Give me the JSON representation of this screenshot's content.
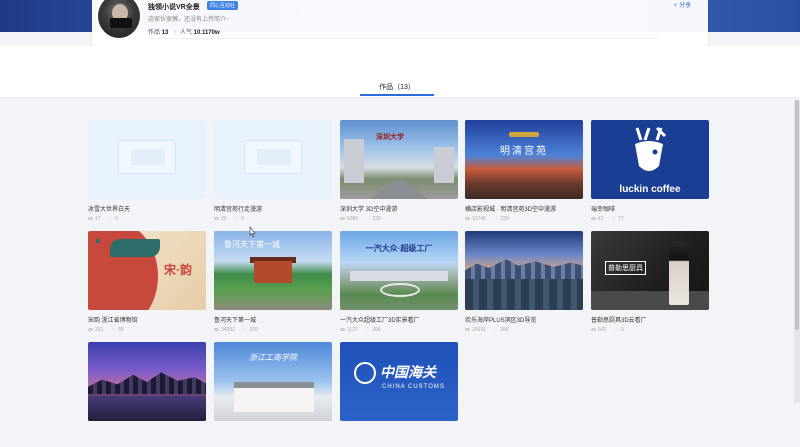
{
  "profile": {
    "name": "独领小说VR全景",
    "badge": "同心互动社",
    "desc": "这家伙很懒，还没有上传简介~",
    "works_label": "作品",
    "works_count": "13",
    "popularity_label": "人气",
    "popularity_value": "10.1170w",
    "share": "分享"
  },
  "tabs": [
    {
      "label": "作品（13）",
      "active": true
    }
  ],
  "cards": [
    {
      "title": "冰雪大世界白天",
      "views": "17",
      "likes": "0",
      "thumb": "blank-icon"
    },
    {
      "title": "明清宫苑行走漫游",
      "views": "20",
      "likes": "0",
      "thumb": "blank-icon"
    },
    {
      "title": "深圳大学 3D空中漫游",
      "views": "6089",
      "likes": "226",
      "thumb": "campus-aerial-image",
      "overlay": "深圳大学"
    },
    {
      "title": "横店影视城 · 明清宫苑3D空中漫游",
      "views": "10749",
      "likes": "239",
      "thumb": "palace-image",
      "overlay": "明清宫苑"
    },
    {
      "title": "瑞幸咖啡",
      "views": "41",
      "likes": "77",
      "thumb": "luckin-logo",
      "overlay": "luckin coffee"
    },
    {
      "title": "宋韵 浙江省博物馆",
      "views": "331",
      "likes": "38",
      "thumb": "song-poster",
      "overlay": "宋·韵"
    },
    {
      "title": "鲁河天下第一城",
      "views": "34952",
      "likes": "209",
      "thumb": "palace-aerial-image",
      "overlay": "鲁河天下第一城"
    },
    {
      "title": "一汽大众超级工厂3D实景看厂",
      "views": "1127",
      "likes": "306",
      "thumb": "factory-image",
      "overlay": "一汽大众·超级工厂"
    },
    {
      "title": "欢乐海岸PLUS滨区3D导览",
      "views": "15531",
      "likes": "355",
      "thumb": "city-dusk-image"
    },
    {
      "title": "普勒思厨具3D云看厂",
      "views": "542",
      "likes": "5",
      "thumb": "kitchen-image",
      "overlay": "普勒思厨具"
    },
    {
      "title": "",
      "views": "",
      "likes": "",
      "thumb": "city-night-image"
    },
    {
      "title": "",
      "views": "",
      "likes": "",
      "thumb": "school-image",
      "overlay": "浙江工商学院"
    },
    {
      "title": "",
      "views": "",
      "likes": "",
      "thumb": "customs-logo",
      "overlay": "中国海关",
      "overlay_sub": "CHINA CUSTOMS"
    }
  ]
}
